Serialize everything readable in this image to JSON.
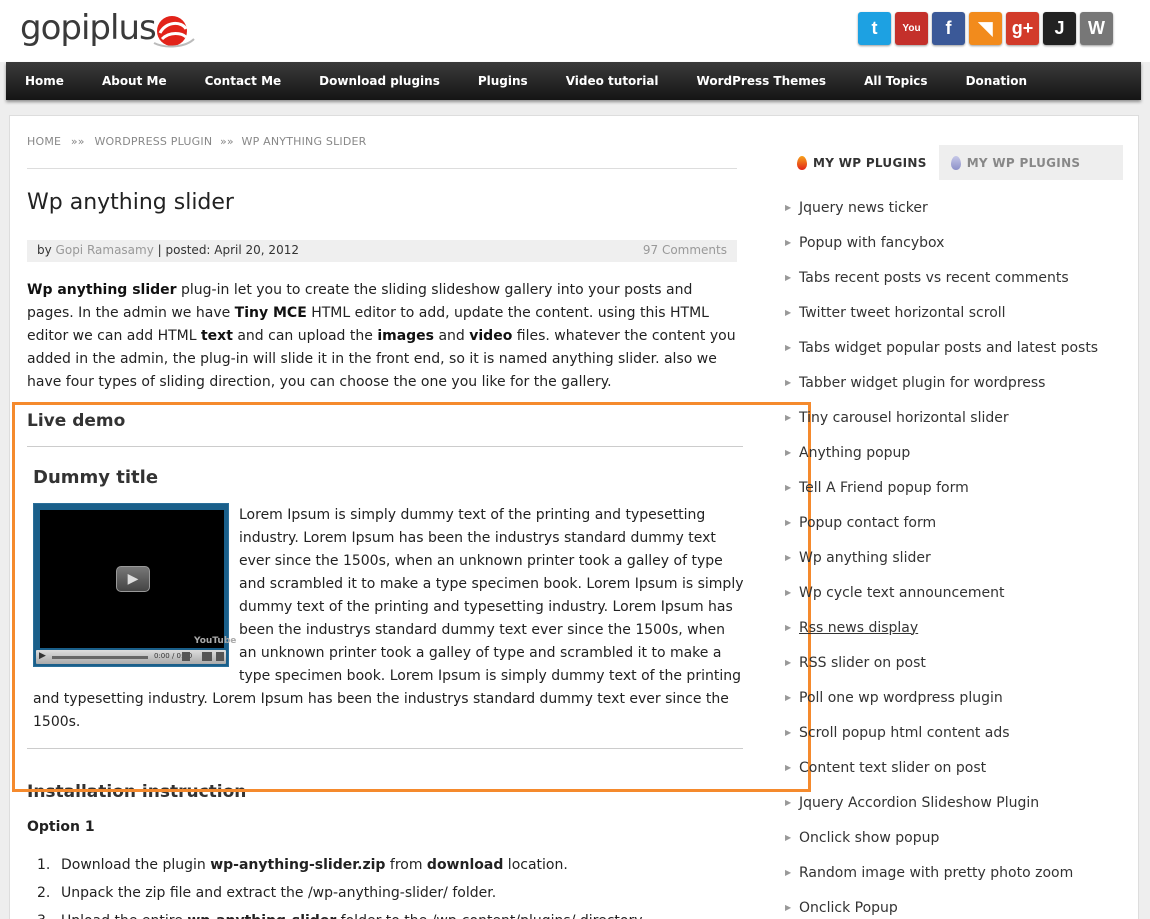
{
  "header": {
    "logo_text": "gopiplus",
    "social_icons": [
      {
        "name": "twitter-icon",
        "color": "#1da1e2",
        "glyph": "t"
      },
      {
        "name": "youtube-icon",
        "color": "#c4302b",
        "glyph": "You"
      },
      {
        "name": "facebook-icon",
        "color": "#3b5998",
        "glyph": "f"
      },
      {
        "name": "rss-icon",
        "color": "#f28b1c",
        "glyph": "◥"
      },
      {
        "name": "google-plus-icon",
        "color": "#d23b2a",
        "glyph": "g+"
      },
      {
        "name": "joomla-icon",
        "color": "#222222",
        "glyph": "J"
      },
      {
        "name": "wordpress-icon",
        "color": "#777777",
        "glyph": "W"
      }
    ]
  },
  "nav": {
    "items": [
      "Home",
      "About Me",
      "Contact Me",
      "Download plugins",
      "Plugins",
      "Video tutorial",
      "WordPress Themes",
      "All Topics",
      "Donation"
    ]
  },
  "breadcrumb": {
    "home": "HOME",
    "sep": "»»",
    "section": "WORDPRESS PLUGIN",
    "current": "WP ANYTHING SLIDER"
  },
  "post": {
    "title": "Wp anything slider",
    "by": "by",
    "author": "Gopi Ramasamy",
    "posted": "| posted: April 20, 2012",
    "comments": "97 Comments"
  },
  "intro": {
    "b1": "Wp anything slider",
    "t1": " plug-in let you to create the sliding slideshow gallery into your posts and pages. In the admin we have ",
    "b2": "Tiny MCE",
    "t2": " HTML editor to add, update the content. using this HTML editor we can add HTML ",
    "b3": "text",
    "t3": " and can upload the ",
    "b4": "images",
    "t4": " and ",
    "b5": "video",
    "t5": " files. whatever the content you added in the admin, the plug-in will slide it in the front end, so it is named anything slider. also we have four types of sliding direction, you can choose the one you like for the gallery."
  },
  "live_demo": {
    "heading": "Live demo",
    "dummy_title": "Dummy title",
    "video_brand": "YouTube",
    "video_time": "0:00 / 0:00",
    "text": "Lorem Ipsum is simply dummy text of the printing and typesetting industry. Lorem Ipsum has been the industrys standard dummy text ever since the 1500s, when an unknown printer took a galley of type and scrambled it to make a type specimen book. Lorem Ipsum is simply dummy text of the printing and typesetting industry. Lorem Ipsum has been the industrys standard dummy text ever since the 1500s, when an unknown printer took a galley of type and scrambled it to make a type specimen book. Lorem Ipsum is simply dummy text of the printing and typesetting industry. Lorem Ipsum has been the industrys standard dummy text ever since the 1500s."
  },
  "install": {
    "heading": "Installation instruction",
    "option": "Option 1",
    "steps": [
      {
        "num": "1.",
        "pre": "Download the plugin ",
        "bold": "wp-anything-slider.zip",
        "mid": " from ",
        "bold2": "download",
        "post": " location."
      },
      {
        "num": "2.",
        "pre": "Unpack the zip file and extract the /wp-anything-slider/ folder.",
        "bold": "",
        "mid": "",
        "bold2": "",
        "post": ""
      },
      {
        "num": "3.",
        "pre": "Upload the entire ",
        "bold": "wp-anything-slider",
        "mid": " folder to the /wp-content/plugins/ directory.",
        "bold2": "",
        "post": ""
      }
    ]
  },
  "sidebar": {
    "tab_active": "MY WP PLUGINS",
    "tab_inactive": "MY WP PLUGINS",
    "items": [
      "Jquery news ticker",
      "Popup with fancybox",
      "Tabs recent posts vs recent comments",
      "Twitter tweet horizontal scroll",
      "Tabs widget popular posts and latest posts",
      "Tabber widget plugin for wordpress",
      "Tiny carousel horizontal slider",
      "Anything popup",
      "Tell A Friend popup form",
      "Popup contact form",
      "Wp anything slider",
      "Wp cycle text announcement",
      "Rss news display",
      "RSS slider on post",
      "Poll one wp wordpress plugin",
      "Scroll popup html content ads",
      "Content text slider on post",
      "Jquery Accordion Slideshow Plugin",
      "Onclick show popup",
      "Random image with pretty photo zoom",
      "Onclick Popup"
    ]
  }
}
